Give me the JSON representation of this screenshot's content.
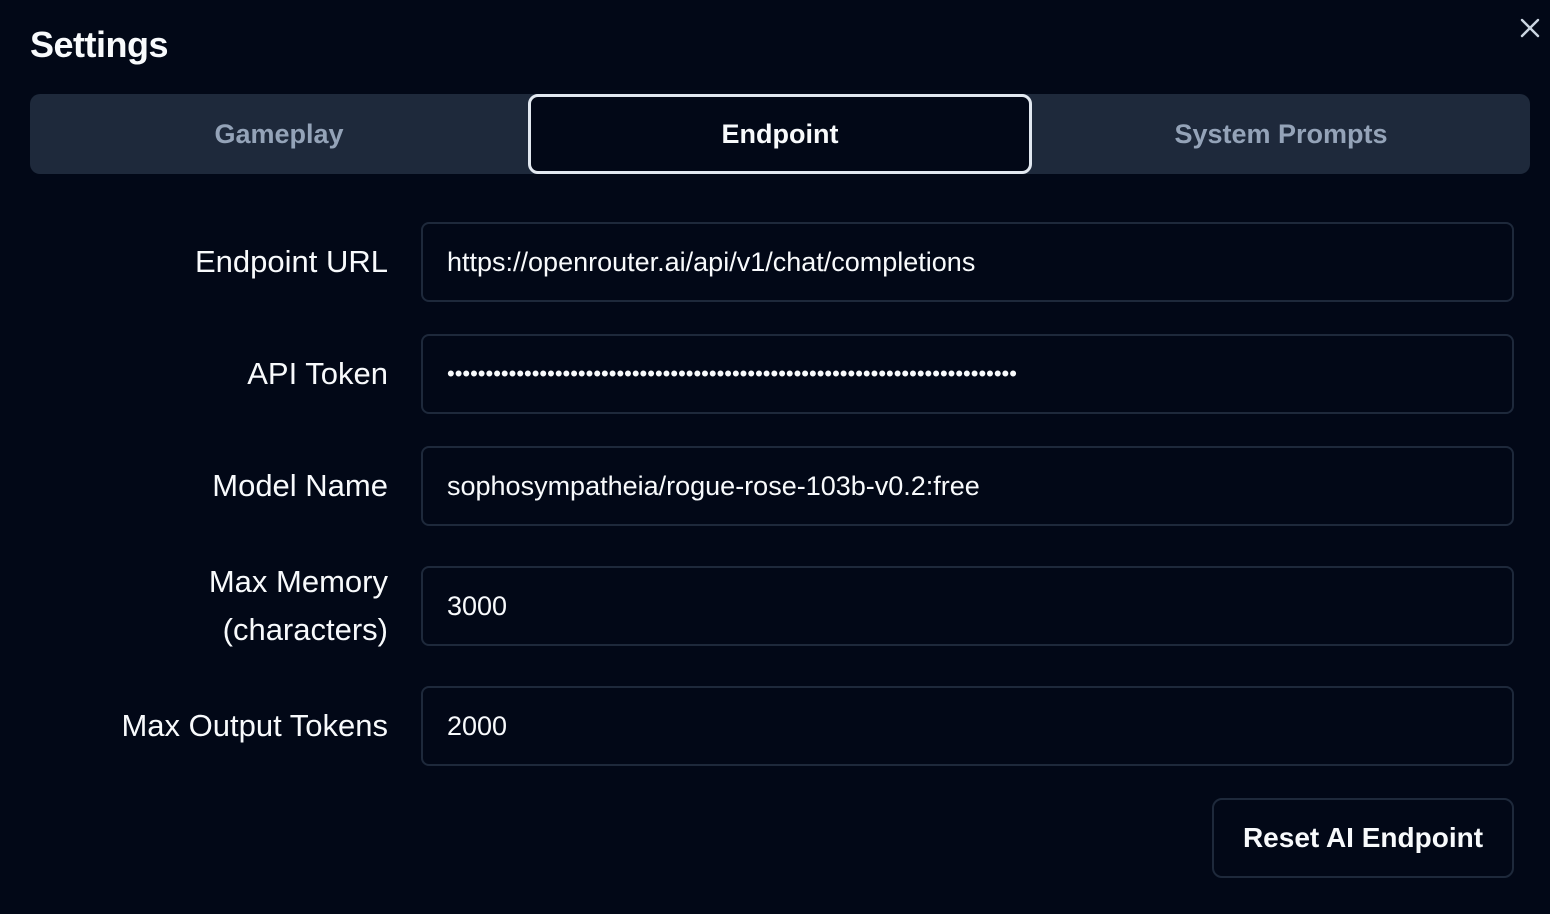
{
  "dialog": {
    "title": "Settings",
    "close_icon": "close-icon"
  },
  "tabs": [
    {
      "label": "Gameplay",
      "active": false
    },
    {
      "label": "Endpoint",
      "active": true
    },
    {
      "label": "System Prompts",
      "active": false
    }
  ],
  "form": {
    "endpoint_url": {
      "label": "Endpoint URL",
      "value": "https://openrouter.ai/api/v1/chat/completions"
    },
    "api_token": {
      "label": "API Token",
      "value": "••••••••••••••••••••••••••••••••••••••••••••••••••••••••••••••••••••••••••"
    },
    "model_name": {
      "label": "Model Name",
      "value": "sophosympatheia/rogue-rose-103b-v0.2:free"
    },
    "max_memory": {
      "label_line1": "Max Memory",
      "label_line2": "(characters)",
      "value": "3000"
    },
    "max_output_tokens": {
      "label": "Max Output Tokens",
      "value": "2000"
    }
  },
  "actions": {
    "reset_label": "Reset AI Endpoint"
  },
  "colors": {
    "background": "#020817",
    "tab_bar": "#1e293b",
    "text": "#f8fafc",
    "muted_text": "#94a3b8",
    "border": "#1e293b",
    "active_tab_border": "#e2e8f0"
  }
}
